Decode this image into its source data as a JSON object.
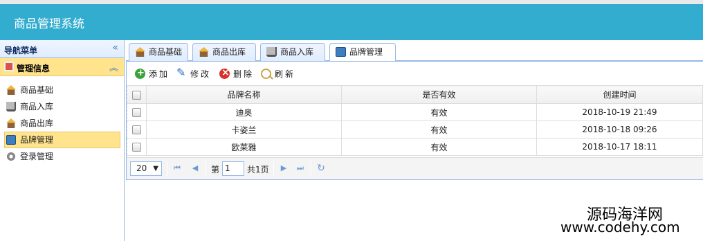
{
  "app": {
    "title": "商品管理系统"
  },
  "nav": {
    "title": "导航菜单",
    "group": "管理信息",
    "items": [
      {
        "label": "商品基础",
        "icon": "home-icon"
      },
      {
        "label": "商品入库",
        "icon": "cart-icon"
      },
      {
        "label": "商品出库",
        "icon": "home-icon"
      },
      {
        "label": "品牌管理",
        "icon": "book-icon"
      },
      {
        "label": "登录管理",
        "icon": "gear-icon"
      }
    ]
  },
  "tabs": [
    {
      "label": "商品基础",
      "closable": false
    },
    {
      "label": "商品出库",
      "closable": true
    },
    {
      "label": "商品入库",
      "closable": true
    },
    {
      "label": "品牌管理",
      "closable": true,
      "active": true
    }
  ],
  "toolbar": {
    "add": "添加",
    "edit": "修改",
    "delete": "删除",
    "refresh": "刷新"
  },
  "grid": {
    "columns": [
      "品牌名称",
      "是否有效",
      "创建时间"
    ],
    "rows": [
      [
        "迪奥",
        "有效",
        "2018-10-19 21:49"
      ],
      [
        "卡姿兰",
        "有效",
        "2018-10-18 09:26"
      ],
      [
        "欧莱雅",
        "有效",
        "2018-10-17 18:11"
      ]
    ]
  },
  "pager": {
    "page_size": "20",
    "page_prefix": "第",
    "page_value": "1",
    "total": "共1页"
  },
  "watermark": {
    "line1": "源码海洋网",
    "line2": "www.codehy.com"
  },
  "colors": {
    "header": "#33adcf",
    "active": "#ffe48d",
    "border": "#95b8e7"
  }
}
